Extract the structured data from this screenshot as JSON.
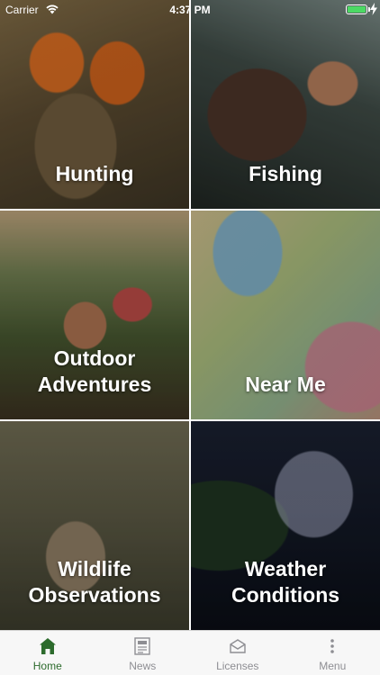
{
  "status_bar": {
    "carrier": "Carrier",
    "time": "4:37 PM"
  },
  "tiles": [
    {
      "lines": [
        "Hunting"
      ]
    },
    {
      "lines": [
        "Fishing"
      ]
    },
    {
      "lines": [
        "Outdoor",
        "Adventures"
      ]
    },
    {
      "lines": [
        "Near Me"
      ]
    },
    {
      "lines": [
        "Wildlife",
        "Observations"
      ]
    },
    {
      "lines": [
        "Weather",
        "Conditions"
      ]
    }
  ],
  "tab_bar": {
    "items": [
      {
        "label": "Home",
        "icon": "home-icon",
        "active": true
      },
      {
        "label": "News",
        "icon": "news-icon",
        "active": false
      },
      {
        "label": "Licenses",
        "icon": "licenses-icon",
        "active": false
      },
      {
        "label": "Menu",
        "icon": "menu-icon",
        "active": false
      }
    ],
    "active_color": "#2d6b2d",
    "inactive_color": "#8e8e93"
  }
}
